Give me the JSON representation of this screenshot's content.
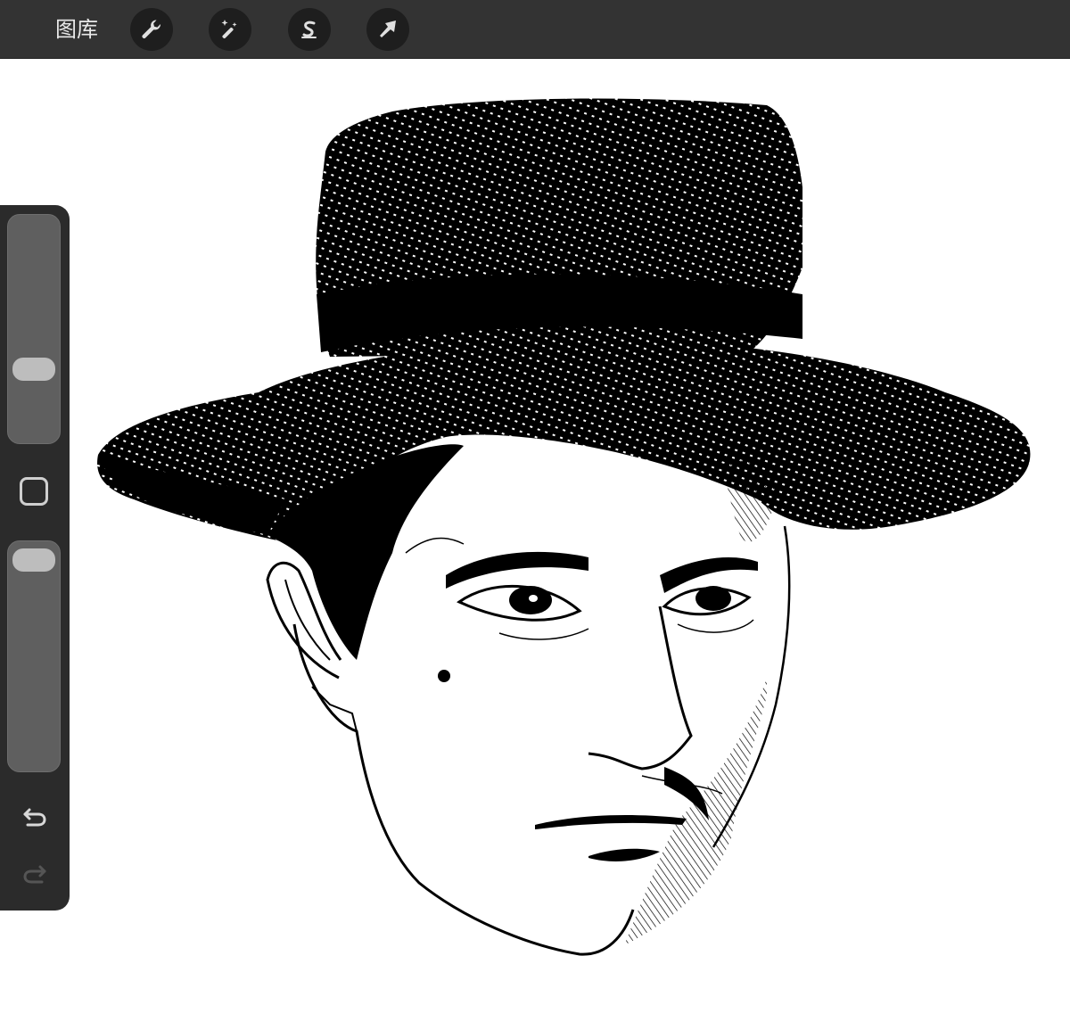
{
  "topbar": {
    "gallery_label": "图库",
    "tools": [
      {
        "name": "actions",
        "icon": "wrench-icon"
      },
      {
        "name": "adjustments",
        "icon": "magic-wand-icon"
      },
      {
        "name": "selection",
        "icon": "selection-s-icon"
      },
      {
        "name": "transform",
        "icon": "arrow-cursor-icon"
      }
    ]
  },
  "sidebar": {
    "brush_size_level": 0.32,
    "opacity_level": 0.96,
    "modifier_icon": "square-icon",
    "undo_icon": "undo-icon",
    "redo_icon": "redo-icon"
  },
  "canvas": {
    "content": "ink-sketch-portrait",
    "colors": {
      "ink": "#000000",
      "paper": "#ffffff"
    }
  },
  "colors": {
    "topbar_bg": "#333333",
    "button_bg": "#1e1e1e",
    "sidebar_bg": "#2b2b2b",
    "icon": "#e0e0e0"
  }
}
